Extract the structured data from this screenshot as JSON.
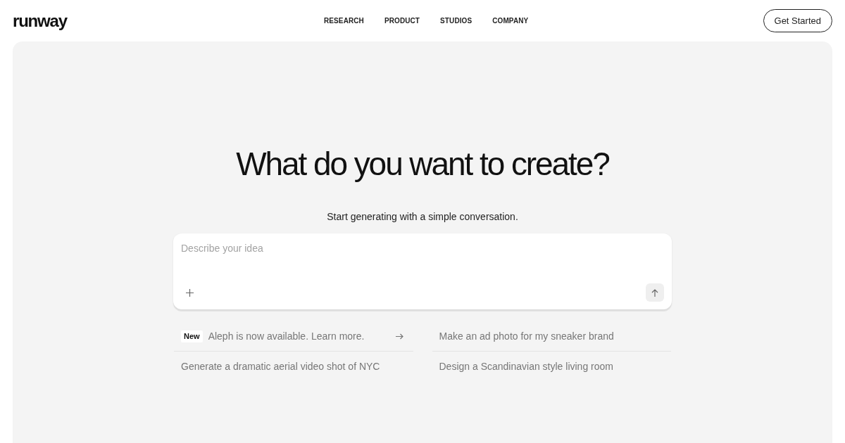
{
  "header": {
    "logo": "runway",
    "nav": [
      {
        "label": "RESEARCH"
      },
      {
        "label": "PRODUCT"
      },
      {
        "label": "STUDIOS"
      },
      {
        "label": "COMPANY"
      }
    ],
    "cta": "Get Started"
  },
  "hero": {
    "title": "What do you want to create?",
    "subtitle": "Start generating with a simple conversation."
  },
  "prompt_box": {
    "placeholder": "Describe your idea"
  },
  "suggestions": [
    {
      "kind": "announcement",
      "badge": "New",
      "text": "Aleph is now available. Learn more."
    },
    {
      "kind": "prompt",
      "text": "Make an ad photo for my sneaker brand"
    },
    {
      "kind": "prompt",
      "text": "Generate a dramatic aerial video shot of NYC"
    },
    {
      "kind": "prompt",
      "text": "Design a Scandinavian style living room"
    }
  ]
}
